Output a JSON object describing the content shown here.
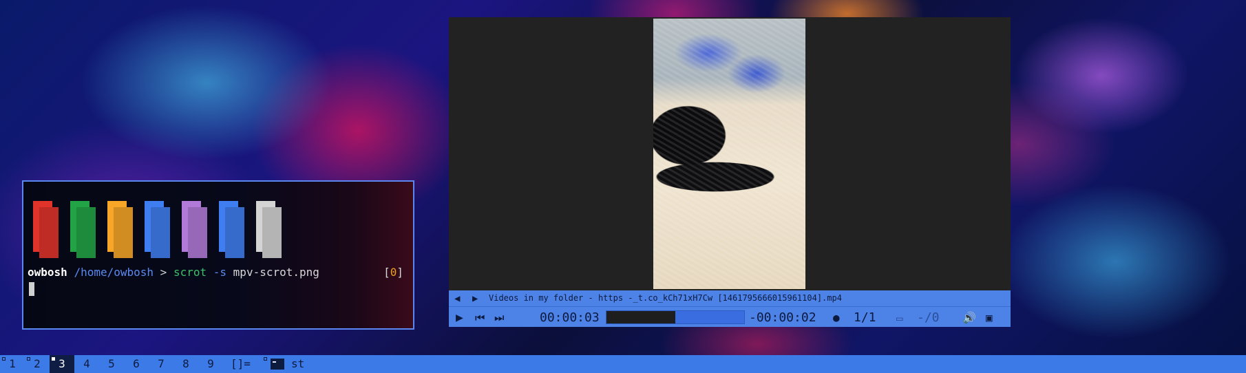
{
  "terminal": {
    "color_blocks": [
      "#e0342b",
      "#22a345",
      "#f7a628",
      "#3f7ef0",
      "#b27ad8",
      "#3f7ef0",
      "#d4d4d4"
    ],
    "prompt_user": "owbosh",
    "prompt_path": "/home/owbosh",
    "prompt_symbol": ">",
    "command": "scrot",
    "command_flag": "-s",
    "command_arg": "mpv-scrot.png",
    "status_open": "[",
    "status_value": "0",
    "status_close": "]"
  },
  "mpv": {
    "title": "Videos in my folder - https -_t.co_kCh71xH7Cw [1461795666015961104].mp4",
    "elapsed": "00:00:03",
    "remaining": "-00:00:02",
    "progress_fraction": 0.5,
    "subtitle_count": "1/1",
    "audio_track": "-/0",
    "icons": [
      "prev-playlist-icon",
      "next-playlist-icon",
      "play-icon",
      "skip-back-icon",
      "skip-forward-icon",
      "subtitle-icon",
      "audio-track-icon",
      "volume-icon",
      "fullscreen-icon"
    ]
  },
  "bar": {
    "workspaces": [
      "1",
      "2",
      "3",
      "4",
      "5",
      "6",
      "7",
      "8",
      "9"
    ],
    "active_workspace": "3",
    "layout_symbol": "[]=",
    "window_title": "st",
    "colors": {
      "bar": "#3c7ae8",
      "active": "#0f1d44"
    }
  }
}
